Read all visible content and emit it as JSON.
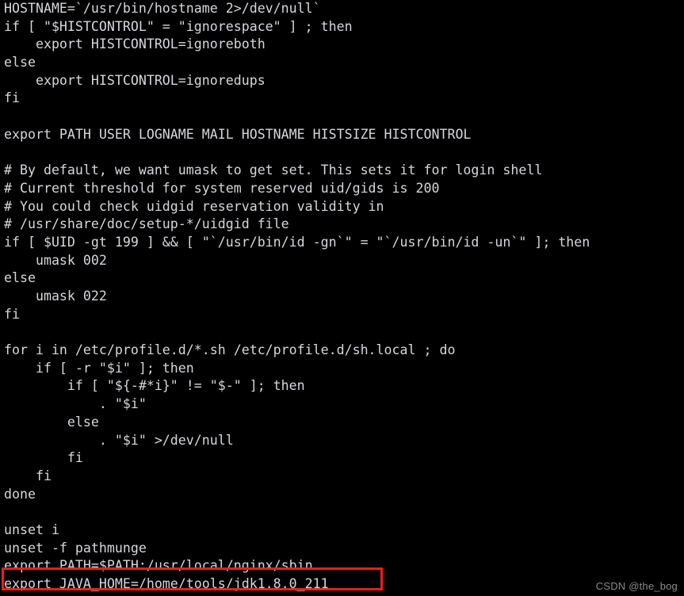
{
  "terminal": {
    "background_color": "#000000",
    "text_color": "#d6d6de",
    "font_size_px": 16.6,
    "line_height_px": 22.7,
    "columns": 84,
    "lines": [
      "HOSTNAME=`/usr/bin/hostname 2>/dev/null`",
      "if [ \"$HISTCONTROL\" = \"ignorespace\" ] ; then",
      "    export HISTCONTROL=ignoreboth",
      "else",
      "    export HISTCONTROL=ignoredups",
      "fi",
      "",
      "export PATH USER LOGNAME MAIL HOSTNAME HISTSIZE HISTCONTROL",
      "",
      "# By default, we want umask to get set. This sets it for login shell",
      "# Current threshold for system reserved uid/gids is 200",
      "# You could check uidgid reservation validity in",
      "# /usr/share/doc/setup-*/uidgid file",
      "if [ $UID -gt 199 ] && [ \"`/usr/bin/id -gn`\" = \"`/usr/bin/id -un`\" ]; then",
      "    umask 002",
      "else",
      "    umask 022",
      "fi",
      "",
      "for i in /etc/profile.d/*.sh /etc/profile.d/sh.local ; do",
      "    if [ -r \"$i\" ]; then",
      "        if [ \"${-#*i}\" != \"$-\" ]; then",
      "            . \"$i\"",
      "        else",
      "            . \"$i\" >/dev/null",
      "        fi",
      "    fi",
      "done",
      "",
      "unset i",
      "unset -f pathmunge",
      "export PATH=$PATH:/usr/local/nginx/sbin",
      "export JAVA_HOME=/home/tools/jdk1.8.0_211"
    ]
  },
  "annotation": {
    "highlight_box": {
      "color": "#f01c1c",
      "target_line": "export PATH=$PATH:/usr/local/nginx/sbin",
      "border_width_px": 3
    }
  },
  "watermark": {
    "text": "CSDN @the_bog",
    "color": "#8a8a8a"
  }
}
